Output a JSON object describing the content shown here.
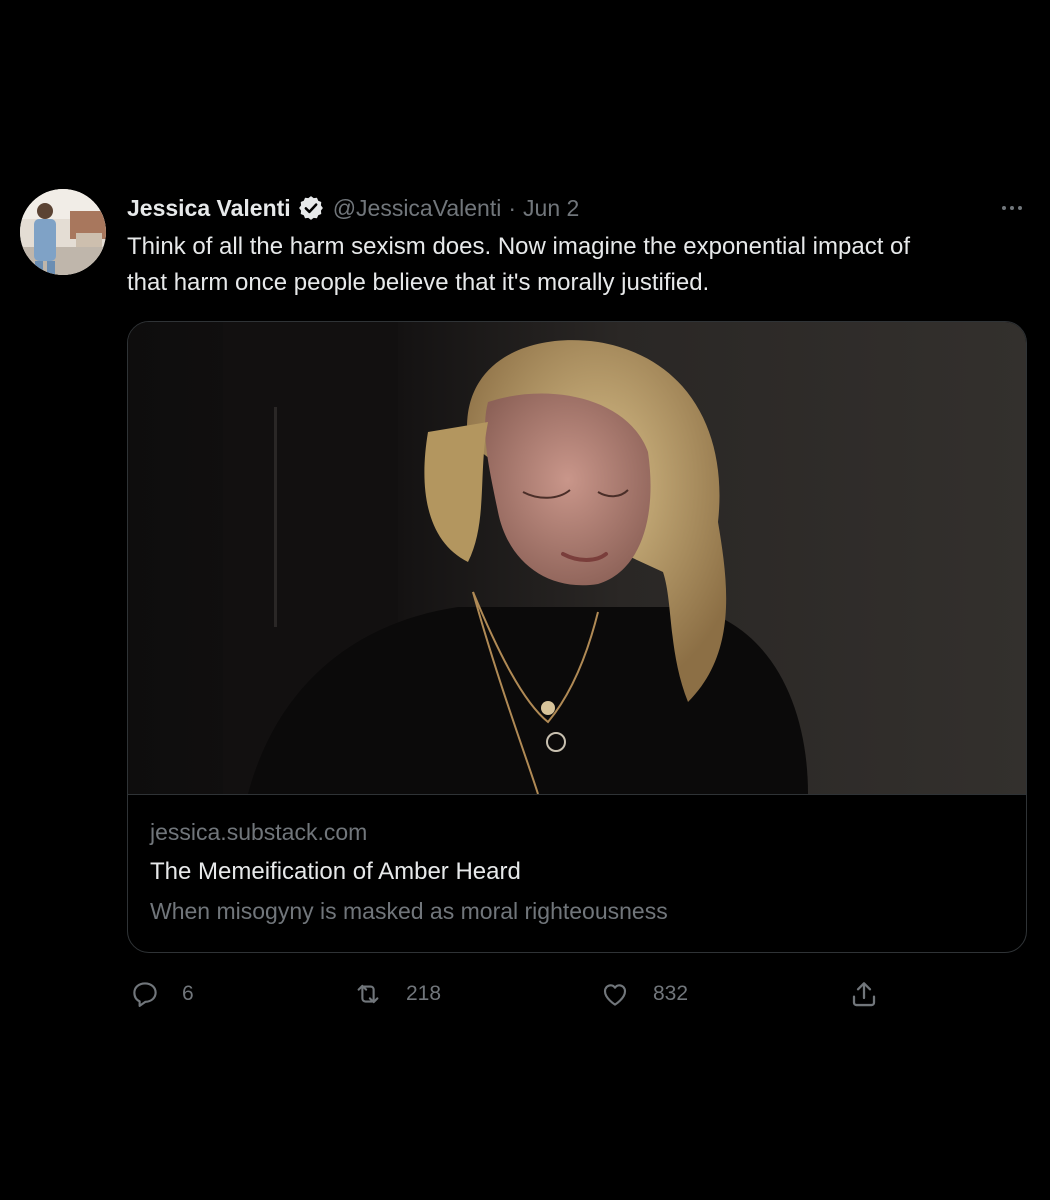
{
  "author": {
    "name": "Jessica Valenti",
    "handle": "@JessicaValenti",
    "separator": "·",
    "date": "Jun 2",
    "verified": true
  },
  "tweet": {
    "text": "Think of all the harm sexism does. Now imagine the exponential impact of\nthat harm once people believe that it's morally justified."
  },
  "card": {
    "domain": "jessica.substack.com",
    "title": "The Memeification of Amber Heard",
    "description": "When misogyny is masked as moral righteousness"
  },
  "actions": {
    "replies": "6",
    "retweets": "218",
    "likes": "832"
  },
  "icons": {
    "verified": "verified-badge-icon",
    "more": "more-dots-icon",
    "reply": "reply-bubble-icon",
    "retweet": "retweet-arrows-icon",
    "like": "heart-icon",
    "share": "share-upload-icon"
  },
  "colors": {
    "background": "#000000",
    "primary_text": "#e7e9ea",
    "secondary_text": "#71767b",
    "border": "#2f3336"
  }
}
